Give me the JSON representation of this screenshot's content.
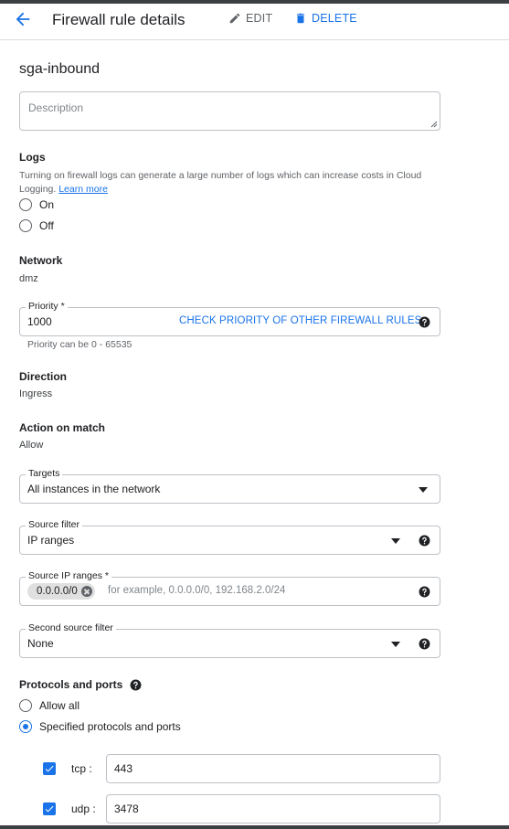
{
  "header": {
    "title": "Firewall rule details",
    "edit_label": "EDIT",
    "delete_label": "DELETE"
  },
  "rule": {
    "name": "sga-inbound",
    "description_placeholder": "Description"
  },
  "logs": {
    "label": "Logs",
    "help_text": "Turning on firewall logs can generate a large number of logs which can increase costs in Cloud Logging.",
    "learn_more": "Learn more",
    "options": [
      "On",
      "Off"
    ]
  },
  "network": {
    "label": "Network",
    "value": "dmz"
  },
  "priority": {
    "label": "Priority *",
    "value": "1000",
    "check_link": "CHECK PRIORITY OF OTHER FIREWALL RULES",
    "hint": "Priority can be 0 - 65535"
  },
  "direction": {
    "label": "Direction",
    "value": "Ingress"
  },
  "action": {
    "label": "Action on match",
    "value": "Allow"
  },
  "targets": {
    "label": "Targets",
    "value": "All instances in the network"
  },
  "source_filter": {
    "label": "Source filter",
    "value": "IP ranges"
  },
  "source_ip_ranges": {
    "label": "Source IP ranges *",
    "chips": [
      "0.0.0.0/0"
    ],
    "placeholder": "for example, 0.0.0.0/0, 192.168.2.0/24"
  },
  "second_source_filter": {
    "label": "Second source filter",
    "value": "None"
  },
  "protocols": {
    "label": "Protocols and ports",
    "options": [
      "Allow all",
      "Specified protocols and ports"
    ],
    "selected": "Specified protocols and ports",
    "entries": [
      {
        "protocol": "tcp :",
        "checked": true,
        "value": "443"
      },
      {
        "protocol": "udp :",
        "checked": true,
        "value": "3478"
      }
    ]
  },
  "colors": {
    "accent": "#1a73e8",
    "text": "#202124",
    "muted": "#5f6368",
    "border": "#bdc1c6"
  }
}
